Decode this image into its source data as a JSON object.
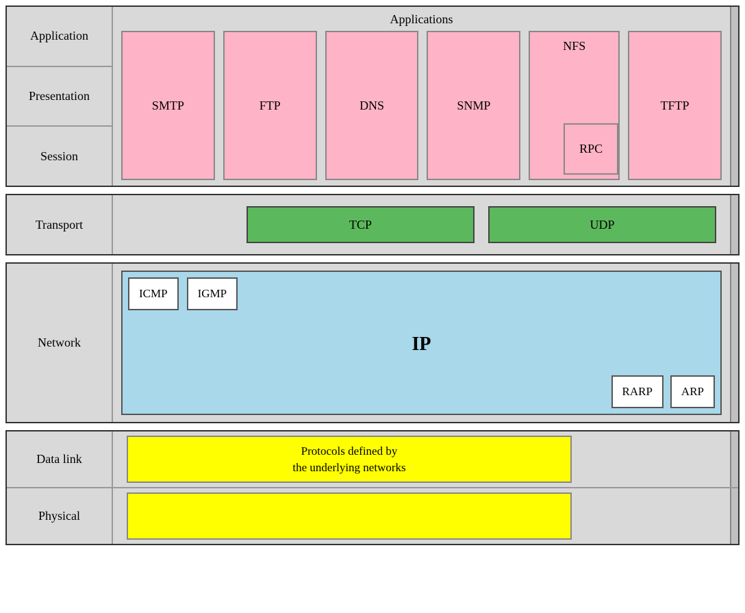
{
  "layers": {
    "application": "Application",
    "presentation": "Presentation",
    "session": "Session",
    "transport": "Transport",
    "network": "Network",
    "datalink": "Data link",
    "physical": "Physical"
  },
  "sections": {
    "app_title": "Applications",
    "protocols_app": [
      "SMTP",
      "FTP",
      "DNS",
      "SNMP",
      "NFS",
      "RPC",
      "TFTP"
    ],
    "protocols_transport": [
      "TCP",
      "UDP"
    ],
    "protocols_network": {
      "floating": [
        "ICMP",
        "IGMP"
      ],
      "main": "IP",
      "bottom": [
        "RARP",
        "ARP"
      ]
    },
    "protocols_datalink_physical": "Protocols defined by\nthe underlying networks"
  }
}
